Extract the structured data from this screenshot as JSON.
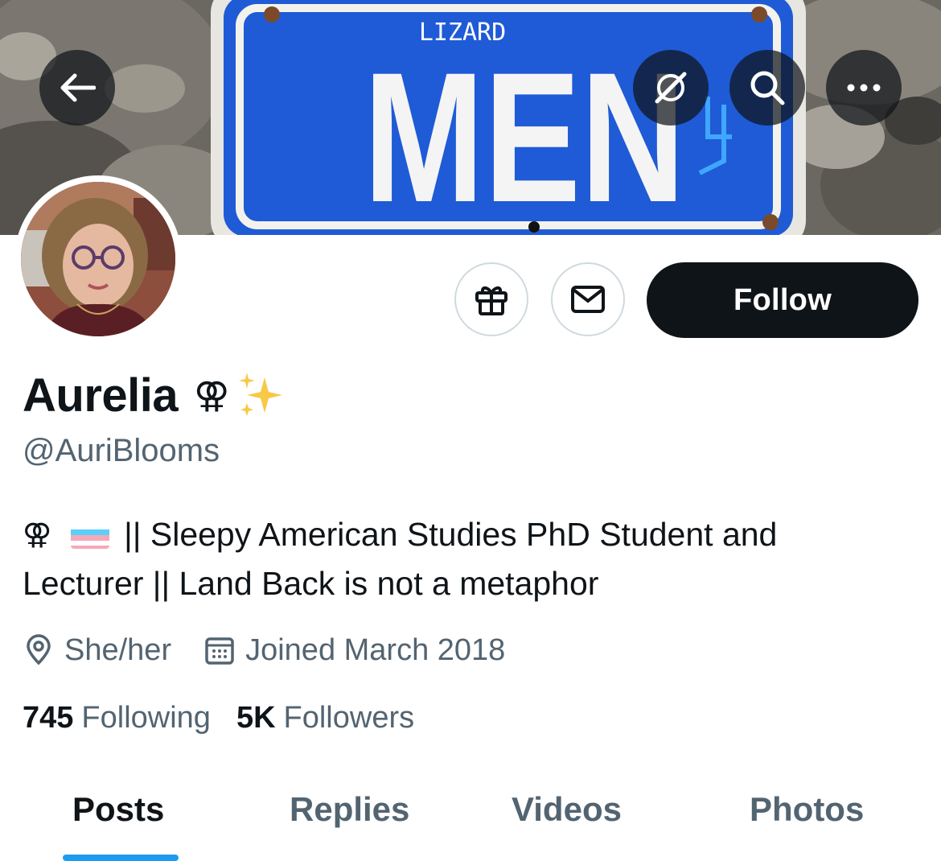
{
  "banner": {
    "sign_small_text": "LIZARD",
    "sign_big_text": "MEN"
  },
  "top_buttons": {
    "back_icon": "arrow-left-icon",
    "grok_icon": "grok-icon",
    "search_icon": "search-icon",
    "more_icon": "more-icon"
  },
  "actions": {
    "gift_icon": "gift-icon",
    "message_icon": "envelope-icon",
    "follow_label": "Follow"
  },
  "profile": {
    "display_name": "Aurelia",
    "name_emoji": "⚢",
    "name_emoji_2": "sparkles-emoji",
    "handle": "@AuriBlooms",
    "bio_line1_emoji": "⚢",
    "bio_flag": "transgender-flag-emoji",
    "bio_line1_text": "|| Sleepy American Studies PhD Student and",
    "bio_line2_text": "Lecturer || Land Back is not a metaphor",
    "location": "She/her",
    "joined": "Joined March 2018",
    "following_count": "745",
    "following_label": "Following",
    "followers_count": "5K",
    "followers_label": "Followers"
  },
  "tabs": [
    {
      "label": "Posts",
      "active": true
    },
    {
      "label": "Replies",
      "active": false
    },
    {
      "label": "Videos",
      "active": false
    },
    {
      "label": "Photos",
      "active": false
    }
  ],
  "colors": {
    "accent": "#1d9bf0",
    "text_primary": "#0f1419",
    "text_secondary": "#536471",
    "sign_blue": "#1f5bd6"
  }
}
